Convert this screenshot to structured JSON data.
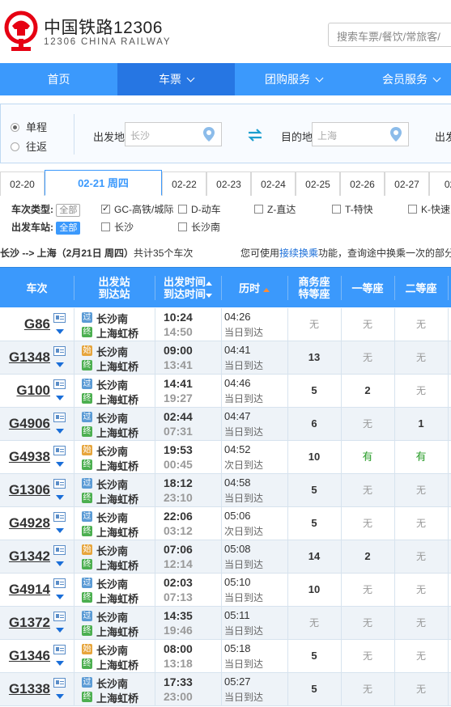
{
  "header": {
    "title": "中国铁路12306",
    "subtitle": "12306 CHINA RAILWAY",
    "search_placeholder": "搜索车票/餐饮/常旅客/",
    "brand_color": "#e60012"
  },
  "nav": {
    "items": [
      {
        "label": "首页",
        "dropdown": false,
        "active": false
      },
      {
        "label": "车票",
        "dropdown": true,
        "active": true
      },
      {
        "label": "团购服务",
        "dropdown": true,
        "active": false
      },
      {
        "label": "会员服务",
        "dropdown": true,
        "active": false
      }
    ],
    "color": "#3b99fc",
    "active_color": "#2676e3"
  },
  "query": {
    "trip_types": [
      {
        "label": "单程",
        "checked": true
      },
      {
        "label": "往返",
        "checked": false
      }
    ],
    "from_label": "出发地",
    "from_value": "长沙",
    "to_label": "目的地",
    "to_value": "上海",
    "date_label": "出发"
  },
  "dates": [
    "02-20",
    "02-21 周四",
    "02-22",
    "02-23",
    "02-24",
    "02-25",
    "02-26",
    "02-27",
    "02-"
  ],
  "active_date_index": 1,
  "filters": {
    "type_label": "车次类型:",
    "station_label": "出发车站:",
    "all_label": "全部",
    "types": [
      {
        "label": "GC-高铁/城际",
        "checked": true
      },
      {
        "label": "D-动车",
        "checked": false
      },
      {
        "label": "Z-直达",
        "checked": false
      },
      {
        "label": "T-特快",
        "checked": false
      },
      {
        "label": "K-快速",
        "checked": false
      }
    ],
    "stations": [
      {
        "label": "长沙",
        "checked": false
      },
      {
        "label": "长沙南",
        "checked": false
      }
    ]
  },
  "summary": {
    "route": "长沙 --> 上海（2月21日  周四）",
    "count_text": "共计35个车次",
    "hint_prefix": "您可使用",
    "hint_link": "接续换乘",
    "hint_suffix": "功能，查询途中换乘一次的部分"
  },
  "table": {
    "headers": {
      "train": "车次",
      "station_top": "出发站",
      "station_bottom": "到达站",
      "time_top": "出发时间",
      "time_bottom": "到达时间",
      "duration": "历时",
      "business_top": "商务座",
      "business_bottom": "特等座",
      "first": "一等座",
      "second": "二等座"
    },
    "rows": [
      {
        "train": "G86",
        "from_type": "过",
        "from": "长沙南",
        "to_type": "终",
        "to": "上海虹桥",
        "dep": "10:24",
        "arr": "14:50",
        "duration": "04:26",
        "arr_day": "当日到达",
        "business": "无",
        "first": "无",
        "second": "无"
      },
      {
        "train": "G1348",
        "from_type": "始",
        "from": "长沙南",
        "to_type": "终",
        "to": "上海虹桥",
        "dep": "09:00",
        "arr": "13:41",
        "duration": "04:41",
        "arr_day": "当日到达",
        "business": "13",
        "first": "无",
        "second": "无"
      },
      {
        "train": "G100",
        "from_type": "过",
        "from": "长沙南",
        "to_type": "终",
        "to": "上海虹桥",
        "dep": "14:41",
        "arr": "19:27",
        "duration": "04:46",
        "arr_day": "当日到达",
        "business": "5",
        "first": "2",
        "second": "无"
      },
      {
        "train": "G4906",
        "from_type": "过",
        "from": "长沙南",
        "to_type": "终",
        "to": "上海虹桥",
        "dep": "02:44",
        "arr": "07:31",
        "duration": "04:47",
        "arr_day": "当日到达",
        "business": "6",
        "first": "无",
        "second": "1"
      },
      {
        "train": "G4938",
        "from_type": "始",
        "from": "长沙南",
        "to_type": "终",
        "to": "上海虹桥",
        "dep": "19:53",
        "arr": "00:45",
        "duration": "04:52",
        "arr_day": "次日到达",
        "business": "10",
        "first": "有",
        "second": "有"
      },
      {
        "train": "G1306",
        "from_type": "过",
        "from": "长沙南",
        "to_type": "终",
        "to": "上海虹桥",
        "dep": "18:12",
        "arr": "23:10",
        "duration": "04:58",
        "arr_day": "当日到达",
        "business": "5",
        "first": "无",
        "second": "无"
      },
      {
        "train": "G4928",
        "from_type": "过",
        "from": "长沙南",
        "to_type": "终",
        "to": "上海虹桥",
        "dep": "22:06",
        "arr": "03:12",
        "duration": "05:06",
        "arr_day": "次日到达",
        "business": "5",
        "first": "无",
        "second": "无"
      },
      {
        "train": "G1342",
        "from_type": "始",
        "from": "长沙南",
        "to_type": "终",
        "to": "上海虹桥",
        "dep": "07:06",
        "arr": "12:14",
        "duration": "05:08",
        "arr_day": "当日到达",
        "business": "14",
        "first": "2",
        "second": "无"
      },
      {
        "train": "G4914",
        "from_type": "过",
        "from": "长沙南",
        "to_type": "终",
        "to": "上海虹桥",
        "dep": "02:03",
        "arr": "07:13",
        "duration": "05:10",
        "arr_day": "当日到达",
        "business": "10",
        "first": "无",
        "second": "无"
      },
      {
        "train": "G1372",
        "from_type": "过",
        "from": "长沙南",
        "to_type": "终",
        "to": "上海虹桥",
        "dep": "14:35",
        "arr": "19:46",
        "duration": "05:11",
        "arr_day": "当日到达",
        "business": "无",
        "first": "无",
        "second": "无"
      },
      {
        "train": "G1346",
        "from_type": "始",
        "from": "长沙南",
        "to_type": "终",
        "to": "上海虹桥",
        "dep": "08:00",
        "arr": "13:18",
        "duration": "05:18",
        "arr_day": "当日到达",
        "business": "5",
        "first": "无",
        "second": "无"
      },
      {
        "train": "G1338",
        "from_type": "过",
        "from": "长沙南",
        "to_type": "终",
        "to": "上海虹桥",
        "dep": "17:33",
        "arr": "23:00",
        "duration": "05:27",
        "arr_day": "当日到达",
        "business": "5",
        "first": "无",
        "second": "无"
      }
    ]
  }
}
